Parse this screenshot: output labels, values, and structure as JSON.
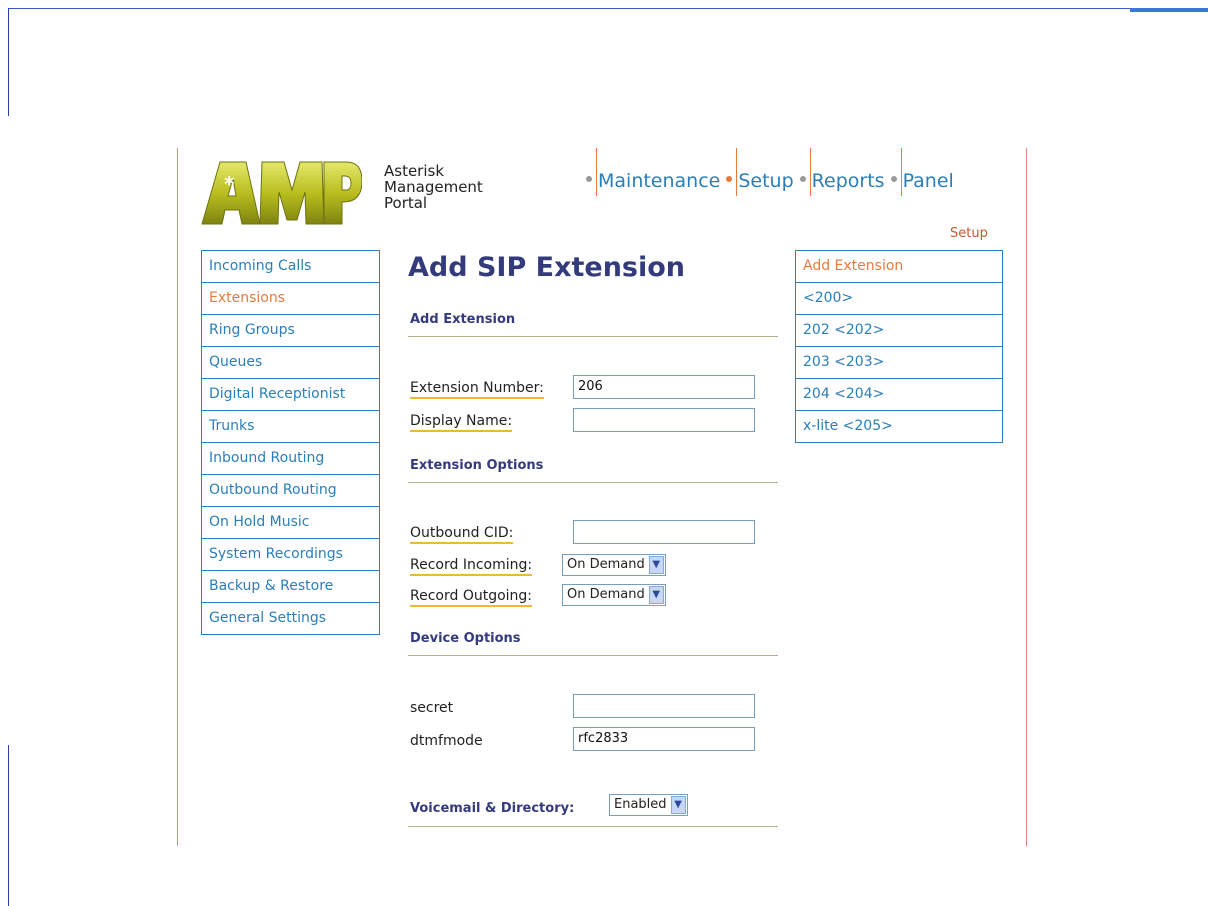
{
  "brand": {
    "logo_text": "AMP",
    "tagline": [
      "Asterisk",
      "Management",
      "Portal"
    ],
    "accent_color": "#e87a3e",
    "link_color": "#2a7fb8",
    "logo_color": "#b9be20"
  },
  "top_nav": [
    {
      "label": "Maintenance",
      "active": false
    },
    {
      "label": "Setup",
      "active": true
    },
    {
      "label": "Reports",
      "active": false
    },
    {
      "label": "Panel",
      "active": false
    }
  ],
  "section_label": "Setup",
  "sidebar": {
    "items": [
      {
        "label": "Incoming Calls"
      },
      {
        "label": "Extensions",
        "active": true
      },
      {
        "label": "Ring Groups"
      },
      {
        "label": "Queues"
      },
      {
        "label": "Digital Receptionist"
      },
      {
        "label": "Trunks"
      },
      {
        "label": "Inbound Routing"
      },
      {
        "label": "Outbound Routing"
      },
      {
        "label": "On Hold Music"
      },
      {
        "label": "System Recordings"
      },
      {
        "label": "Backup & Restore"
      },
      {
        "label": "General Settings"
      }
    ]
  },
  "extension_list": {
    "items": [
      {
        "label": "Add Extension",
        "active": true
      },
      {
        "label": "<200>"
      },
      {
        "label": "202 <202>"
      },
      {
        "label": "203 <203>"
      },
      {
        "label": "204 <204>"
      },
      {
        "label": "x-lite <205>"
      }
    ]
  },
  "form": {
    "title": "Add SIP Extension",
    "add_extension_heading": "Add Extension",
    "extension_number_label": "Extension Number:",
    "extension_number_value": "206",
    "display_name_label": "Display Name:",
    "display_name_value": "",
    "extension_options_heading": "Extension Options",
    "outbound_cid_label": "Outbound CID:",
    "outbound_cid_value": "",
    "record_incoming_label": "Record Incoming:",
    "record_incoming_value": "On Demand",
    "record_outgoing_label": "Record Outgoing:",
    "record_outgoing_value": "On Demand",
    "device_options_heading": "Device Options",
    "secret_label": "secret",
    "secret_value": "",
    "dtmfmode_label": "dtmfmode",
    "dtmfmode_value": "rfc2833",
    "voicemail_label": "Voicemail & Directory:",
    "voicemail_value": "Enabled"
  }
}
